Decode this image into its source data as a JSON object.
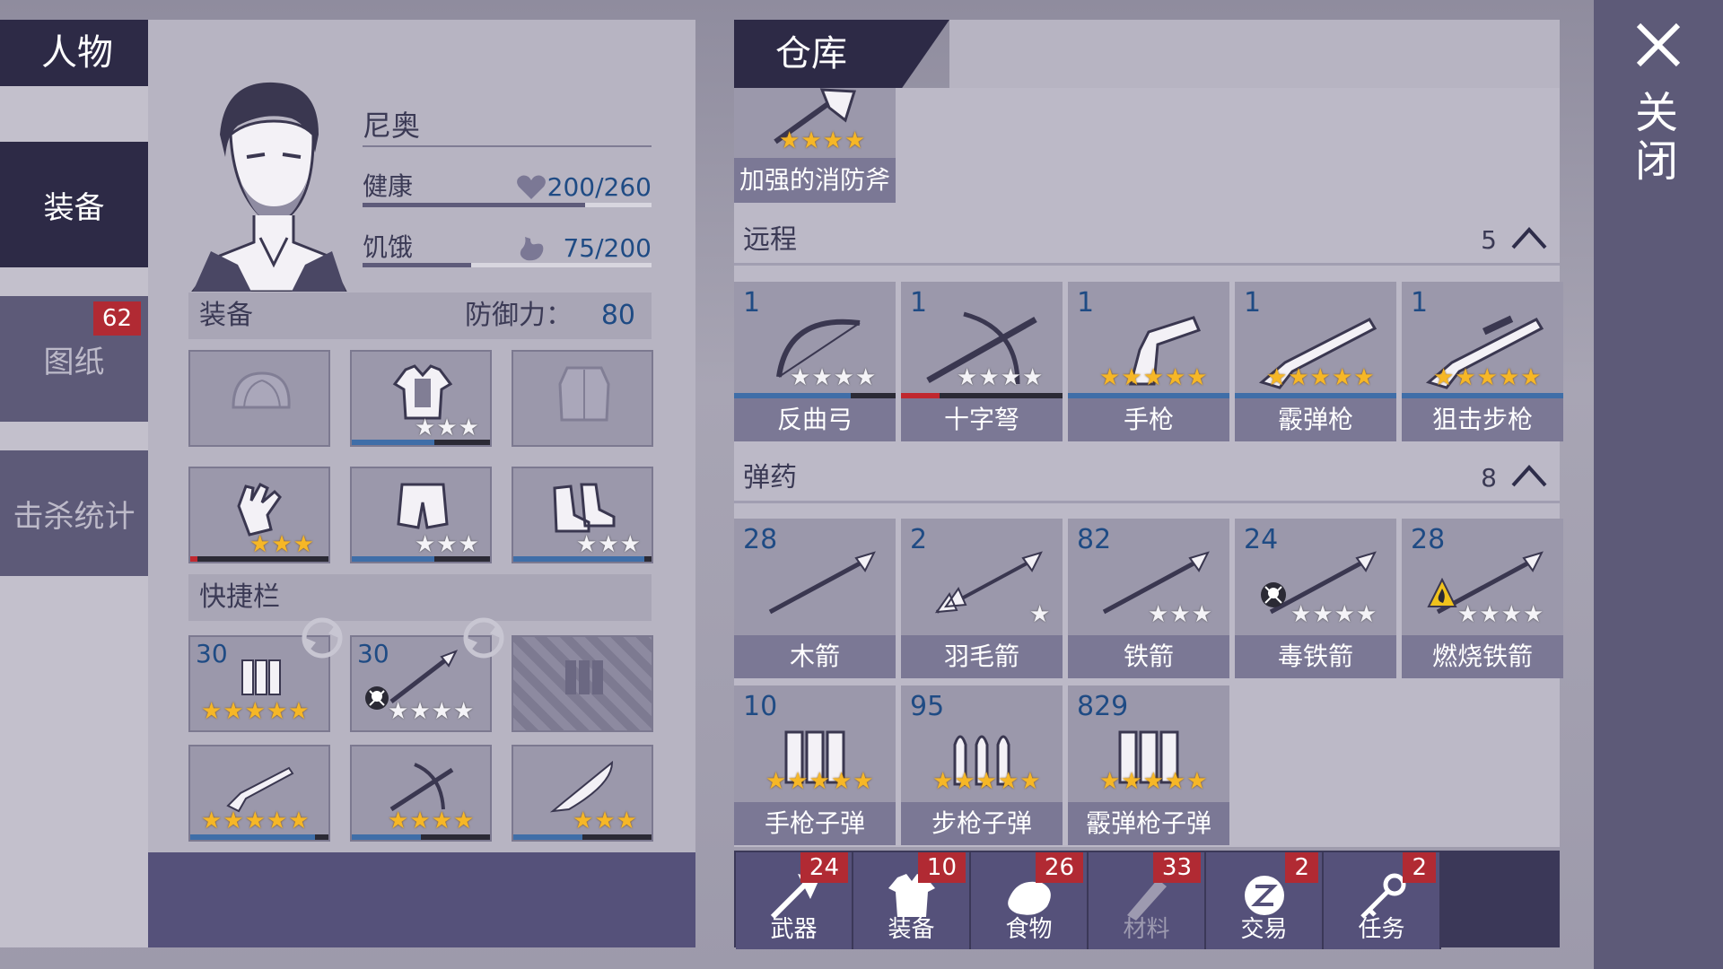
{
  "nav": {
    "title": "人物",
    "tabs": [
      {
        "label": "装备",
        "active": true
      },
      {
        "label": "图纸",
        "badge": "62"
      },
      {
        "label": "击杀统计"
      }
    ]
  },
  "character": {
    "name": "尼奥",
    "health_label": "健康",
    "health_value": "200/260",
    "health_fraction": 0.77,
    "hunger_label": "饥饿",
    "hunger_value": "75/200",
    "hunger_fraction": 0.375,
    "equipment_title": "装备",
    "defense_label": "防御力：",
    "defense_value": "80",
    "quickbar_title": "快捷栏"
  },
  "equipment_slots": [
    {
      "name": "hat",
      "stars_gold": 0,
      "stars_white": 0,
      "durability": null
    },
    {
      "name": "shirt",
      "stars_gold": 0,
      "stars_white": 3,
      "durability": 0.6
    },
    {
      "name": "jacket",
      "stars_gold": 0,
      "stars_white": 0,
      "durability": null
    },
    {
      "name": "gloves",
      "stars_gold": 3,
      "stars_white": 0,
      "durability": 0.05,
      "durability_color": "#c0282f"
    },
    {
      "name": "pants",
      "stars_gold": 0,
      "stars_white": 3,
      "durability": 0.6
    },
    {
      "name": "boots",
      "stars_gold": 0,
      "stars_white": 3,
      "durability": 0.95
    }
  ],
  "quickbar": [
    {
      "name": "ammo",
      "qty": "30",
      "stars_gold": 5,
      "stars_white": 0
    },
    {
      "name": "poison-arrow",
      "qty": "30",
      "stars_gold": 0,
      "stars_white": 4
    },
    {
      "name": "empty-ammo-slot"
    },
    {
      "name": "shotgun",
      "stars_gold": 5,
      "stars_white": 0,
      "durability": 0.9
    },
    {
      "name": "crossbow",
      "stars_gold": 4,
      "stars_white": 0,
      "durability": 0.5
    },
    {
      "name": "machete",
      "stars_gold": 3,
      "stars_white": 0,
      "durability": 0.5
    }
  ],
  "warehouse": {
    "title": "仓库",
    "featured": {
      "label": "加强的消防斧",
      "stars_gold": 4
    },
    "ranged": {
      "title": "远程",
      "count": "5",
      "items": [
        {
          "qty": "1",
          "label": "反曲弓",
          "stars_gold": 0,
          "stars_white": 4,
          "durability": 0.72,
          "dur_color": "#3f6ea8"
        },
        {
          "qty": "1",
          "label": "十字弩",
          "stars_gold": 0,
          "stars_white": 4,
          "durability": 0.24,
          "dur_color": "#c0282f"
        },
        {
          "qty": "1",
          "label": "手枪",
          "stars_gold": 5,
          "stars_white": 0,
          "durability": 1.0,
          "dur_color": "#3f6ea8"
        },
        {
          "qty": "1",
          "label": "霰弹枪",
          "stars_gold": 5,
          "stars_white": 0,
          "durability": 1.0,
          "dur_color": "#3f6ea8"
        },
        {
          "qty": "1",
          "label": "狙击步枪",
          "stars_gold": 5,
          "stars_white": 0,
          "durability": 1.0,
          "dur_color": "#3f6ea8"
        }
      ]
    },
    "ammo": {
      "title": "弹药",
      "count": "8",
      "items": [
        {
          "qty": "28",
          "label": "木箭",
          "stars_gold": 0,
          "stars_white": 0
        },
        {
          "qty": "2",
          "label": "羽毛箭",
          "stars_gold": 0,
          "stars_white": 1
        },
        {
          "qty": "82",
          "label": "铁箭",
          "stars_gold": 0,
          "stars_white": 3
        },
        {
          "qty": "24",
          "label": "毒铁箭",
          "stars_gold": 0,
          "stars_white": 4
        },
        {
          "qty": "28",
          "label": "燃烧铁箭",
          "stars_gold": 0,
          "stars_white": 4
        },
        {
          "qty": "10",
          "label": "手枪子弹",
          "stars_gold": 5,
          "stars_white": 0
        },
        {
          "qty": "95",
          "label": "步枪子弹",
          "stars_gold": 5,
          "stars_white": 0
        },
        {
          "qty": "829",
          "label": "霰弹枪子弹",
          "stars_gold": 5,
          "stars_white": 0
        }
      ]
    }
  },
  "bottom_tabs": [
    {
      "label": "武器",
      "badge": "24",
      "icon": "axe-icon"
    },
    {
      "label": "装备",
      "badge": "10",
      "icon": "shirt-icon"
    },
    {
      "label": "食物",
      "badge": "26",
      "icon": "meat-icon"
    },
    {
      "label": "材料",
      "badge": "33",
      "icon": "wood-icon"
    },
    {
      "label": "交易",
      "badge": "2",
      "icon": "coin-icon"
    },
    {
      "label": "任务",
      "badge": "2",
      "icon": "key-icon"
    }
  ],
  "close_label": "关闭",
  "colors": {
    "gold_star": "#f6b726",
    "qty_blue": "#1f4b84",
    "badge_red": "#b12a33",
    "dark_panel": "#2d2a46"
  }
}
